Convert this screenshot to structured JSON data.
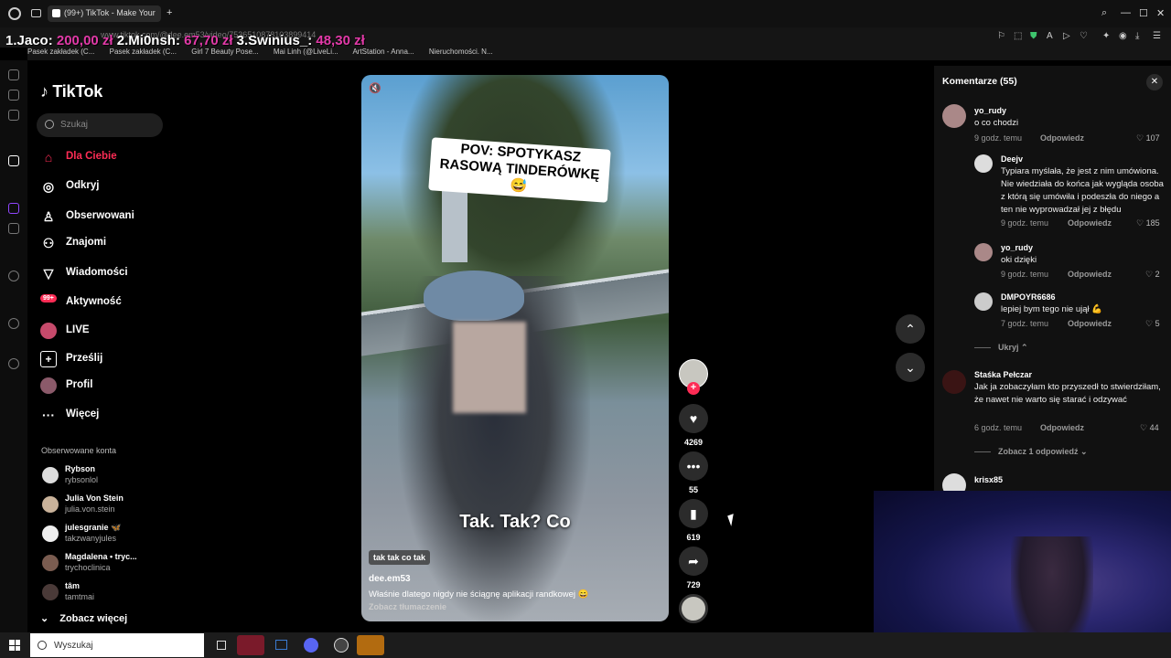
{
  "browser": {
    "tab_title": "(99+) TikTok - Make Your",
    "url": "www.tiktok.com/@dee.em53/video/7536510878103899414",
    "bookmarks": [
      "Pasek zakładek (C...",
      "Pasek zakładek (C...",
      "Girl 7 Beauty Pose...",
      "Mai Linh (@LiveLi...",
      "ArtStation - Anna...",
      "Nieruchomości. N..."
    ]
  },
  "donations": {
    "entry1_name": "1.Jaco:",
    "entry1_amount": "200,00 zł",
    "entry2_name": "2.Mi0nsh:",
    "entry2_amount": "67,70 zł",
    "entry3_name": "3.Swinius_:",
    "entry3_amount": "48,30 zł"
  },
  "sidebar": {
    "logo": "TikTok",
    "search_placeholder": "Szukaj",
    "nav": [
      {
        "label": "Dla Ciebie",
        "icon": "home-icon"
      },
      {
        "label": "Odkryj",
        "icon": "compass-icon"
      },
      {
        "label": "Obserwowani",
        "icon": "following-icon"
      },
      {
        "label": "Znajomi",
        "icon": "friends-icon"
      },
      {
        "label": "Wiadomości",
        "icon": "messages-icon"
      },
      {
        "label": "Aktywność",
        "icon": "activity-icon",
        "badge": "99+"
      },
      {
        "label": "LIVE",
        "icon": "live-icon"
      },
      {
        "label": "Prześlij",
        "icon": "upload-icon"
      },
      {
        "label": "Profil",
        "icon": "profile-icon"
      },
      {
        "label": "Więcej",
        "icon": "more-icon"
      }
    ],
    "followed_header": "Obserwowane konta",
    "followed": [
      {
        "name": "Rybson",
        "user": "rybsonlol"
      },
      {
        "name": "Julia Von Stein",
        "user": "julia.von.stein"
      },
      {
        "name": "julesgranie 🦋",
        "user": "takzwanyjules"
      },
      {
        "name": "Magdalena • tryc...",
        "user": "trychoclinica"
      },
      {
        "name": "tâm",
        "user": "tamtmai"
      }
    ],
    "see_more": "Zobacz więcej"
  },
  "video": {
    "top_caption": "POV: SPOTYKASZ RASOWĄ TINDERÓWKĘ 😅",
    "subtitle": "Tak. Tak? Co",
    "sound_label": "tak tak co tak",
    "author": "dee.em53",
    "description": "Właśnie dlatego nigdy nie ściągnę aplikacji randkowej 😄",
    "translate": "Zobacz tłumaczenie"
  },
  "actions": {
    "likes": "4269",
    "comments": "55",
    "saves": "619",
    "shares": "729"
  },
  "comments_panel": {
    "title": "Komentarze (55)",
    "items": [
      {
        "user": "yo_rudy",
        "text": "o co chodzi",
        "time": "9 godz. temu",
        "reply": "Odpowiedz",
        "likes": "107"
      },
      {
        "user": "Deejv",
        "text": "Typiara myślała, że jest z nim umówiona. Nie wiedziała do końca jak wygląda osoba z którą się umówiła i podeszła do niego a ten nie wyprowadzał jej z błędu",
        "time": "9 godz. temu",
        "reply": "Odpowiedz",
        "likes": "185"
      },
      {
        "user": "yo_rudy",
        "text": "oki dzięki",
        "time": "9 godz. temu",
        "reply": "Odpowiedz",
        "likes": "2"
      },
      {
        "user": "DMPOYR6686",
        "text": "lepiej bym tego nie ujął 💪",
        "time": "7 godz. temu",
        "reply": "Odpowiedz",
        "likes": "5"
      },
      {
        "user": "Staśka Pełczar",
        "text": "Jak ja zobaczyłam kto przyszedł to stwierdziłam, że nawet nie warto się starać i odzywać",
        "time": "6 godz. temu",
        "reply": "Odpowiedz",
        "likes": "44"
      },
      {
        "user": "krisx85",
        "text": "",
        "time": "",
        "reply": "",
        "likes": ""
      }
    ],
    "hide_label": "Ukryj",
    "show_replies": "Zobacz 1 odpowiedź"
  },
  "taskbar": {
    "search_placeholder": "Wyszukaj"
  },
  "colors": {
    "accent": "#fe2c55",
    "donation_amount": "#e23aa8"
  }
}
